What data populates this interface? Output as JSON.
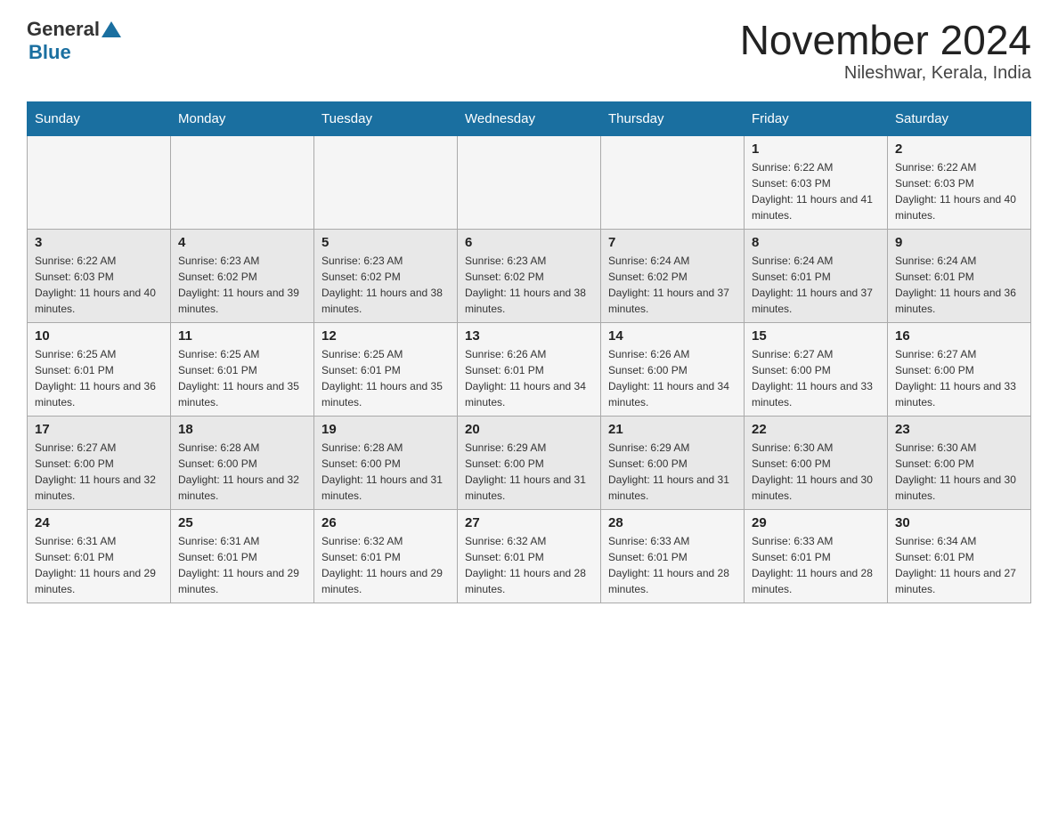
{
  "header": {
    "logo_general": "General",
    "logo_blue": "Blue",
    "title": "November 2024",
    "subtitle": "Nileshwar, Kerala, India"
  },
  "calendar": {
    "days_of_week": [
      "Sunday",
      "Monday",
      "Tuesday",
      "Wednesday",
      "Thursday",
      "Friday",
      "Saturday"
    ],
    "weeks": [
      [
        {
          "day": "",
          "info": ""
        },
        {
          "day": "",
          "info": ""
        },
        {
          "day": "",
          "info": ""
        },
        {
          "day": "",
          "info": ""
        },
        {
          "day": "",
          "info": ""
        },
        {
          "day": "1",
          "info": "Sunrise: 6:22 AM\nSunset: 6:03 PM\nDaylight: 11 hours and 41 minutes."
        },
        {
          "day": "2",
          "info": "Sunrise: 6:22 AM\nSunset: 6:03 PM\nDaylight: 11 hours and 40 minutes."
        }
      ],
      [
        {
          "day": "3",
          "info": "Sunrise: 6:22 AM\nSunset: 6:03 PM\nDaylight: 11 hours and 40 minutes."
        },
        {
          "day": "4",
          "info": "Sunrise: 6:23 AM\nSunset: 6:02 PM\nDaylight: 11 hours and 39 minutes."
        },
        {
          "day": "5",
          "info": "Sunrise: 6:23 AM\nSunset: 6:02 PM\nDaylight: 11 hours and 38 minutes."
        },
        {
          "day": "6",
          "info": "Sunrise: 6:23 AM\nSunset: 6:02 PM\nDaylight: 11 hours and 38 minutes."
        },
        {
          "day": "7",
          "info": "Sunrise: 6:24 AM\nSunset: 6:02 PM\nDaylight: 11 hours and 37 minutes."
        },
        {
          "day": "8",
          "info": "Sunrise: 6:24 AM\nSunset: 6:01 PM\nDaylight: 11 hours and 37 minutes."
        },
        {
          "day": "9",
          "info": "Sunrise: 6:24 AM\nSunset: 6:01 PM\nDaylight: 11 hours and 36 minutes."
        }
      ],
      [
        {
          "day": "10",
          "info": "Sunrise: 6:25 AM\nSunset: 6:01 PM\nDaylight: 11 hours and 36 minutes."
        },
        {
          "day": "11",
          "info": "Sunrise: 6:25 AM\nSunset: 6:01 PM\nDaylight: 11 hours and 35 minutes."
        },
        {
          "day": "12",
          "info": "Sunrise: 6:25 AM\nSunset: 6:01 PM\nDaylight: 11 hours and 35 minutes."
        },
        {
          "day": "13",
          "info": "Sunrise: 6:26 AM\nSunset: 6:01 PM\nDaylight: 11 hours and 34 minutes."
        },
        {
          "day": "14",
          "info": "Sunrise: 6:26 AM\nSunset: 6:00 PM\nDaylight: 11 hours and 34 minutes."
        },
        {
          "day": "15",
          "info": "Sunrise: 6:27 AM\nSunset: 6:00 PM\nDaylight: 11 hours and 33 minutes."
        },
        {
          "day": "16",
          "info": "Sunrise: 6:27 AM\nSunset: 6:00 PM\nDaylight: 11 hours and 33 minutes."
        }
      ],
      [
        {
          "day": "17",
          "info": "Sunrise: 6:27 AM\nSunset: 6:00 PM\nDaylight: 11 hours and 32 minutes."
        },
        {
          "day": "18",
          "info": "Sunrise: 6:28 AM\nSunset: 6:00 PM\nDaylight: 11 hours and 32 minutes."
        },
        {
          "day": "19",
          "info": "Sunrise: 6:28 AM\nSunset: 6:00 PM\nDaylight: 11 hours and 31 minutes."
        },
        {
          "day": "20",
          "info": "Sunrise: 6:29 AM\nSunset: 6:00 PM\nDaylight: 11 hours and 31 minutes."
        },
        {
          "day": "21",
          "info": "Sunrise: 6:29 AM\nSunset: 6:00 PM\nDaylight: 11 hours and 31 minutes."
        },
        {
          "day": "22",
          "info": "Sunrise: 6:30 AM\nSunset: 6:00 PM\nDaylight: 11 hours and 30 minutes."
        },
        {
          "day": "23",
          "info": "Sunrise: 6:30 AM\nSunset: 6:00 PM\nDaylight: 11 hours and 30 minutes."
        }
      ],
      [
        {
          "day": "24",
          "info": "Sunrise: 6:31 AM\nSunset: 6:01 PM\nDaylight: 11 hours and 29 minutes."
        },
        {
          "day": "25",
          "info": "Sunrise: 6:31 AM\nSunset: 6:01 PM\nDaylight: 11 hours and 29 minutes."
        },
        {
          "day": "26",
          "info": "Sunrise: 6:32 AM\nSunset: 6:01 PM\nDaylight: 11 hours and 29 minutes."
        },
        {
          "day": "27",
          "info": "Sunrise: 6:32 AM\nSunset: 6:01 PM\nDaylight: 11 hours and 28 minutes."
        },
        {
          "day": "28",
          "info": "Sunrise: 6:33 AM\nSunset: 6:01 PM\nDaylight: 11 hours and 28 minutes."
        },
        {
          "day": "29",
          "info": "Sunrise: 6:33 AM\nSunset: 6:01 PM\nDaylight: 11 hours and 28 minutes."
        },
        {
          "day": "30",
          "info": "Sunrise: 6:34 AM\nSunset: 6:01 PM\nDaylight: 11 hours and 27 minutes."
        }
      ]
    ]
  }
}
